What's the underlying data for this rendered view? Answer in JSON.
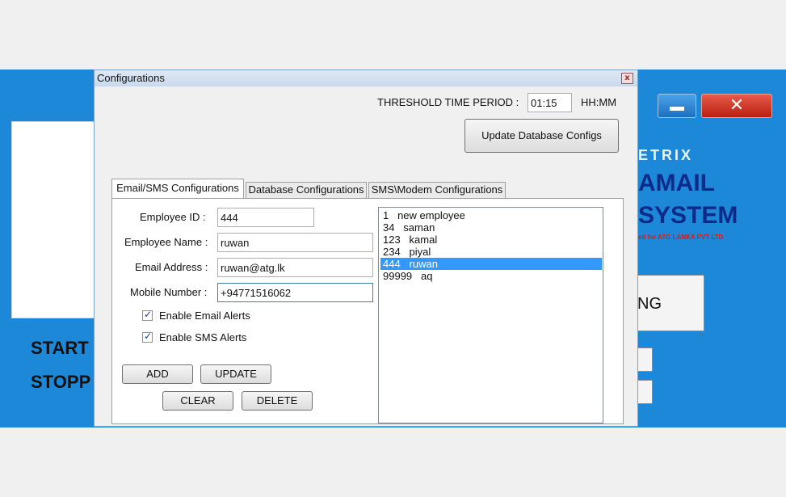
{
  "background_app": {
    "start_label": "START",
    "stop_label": "STOPP",
    "logo_line1": "ETRIX",
    "logo_line2": "AMAIL",
    "logo_line3": "SYSTEM",
    "logo_line4": "ed for ATG LANKA PVT LTD",
    "big_button_label": "NG",
    "minimize_icon": "minimize-icon",
    "close_icon": "close-icon",
    "close_glyph": "✕"
  },
  "dialog": {
    "title": "Configurations",
    "close_glyph": "x",
    "threshold_label": "THRESHOLD TIME PERIOD :",
    "threshold_value": "01:15",
    "threshold_format": "HH:MM",
    "update_db_button": "Update Database Configs",
    "tabs": [
      {
        "label": "Email/SMS Configurations",
        "active": true
      },
      {
        "label": "Database Configurations",
        "active": false
      },
      {
        "label": "SMS\\Modem Configurations",
        "active": false
      }
    ],
    "form": {
      "employee_id_label": "Employee ID :",
      "employee_id_value": "444",
      "employee_name_label": "Employee Name :",
      "employee_name_value": "ruwan",
      "email_label": "Email Address :",
      "email_value": "ruwan@atg.lk",
      "mobile_label": "Mobile Number :",
      "mobile_value": "+94771516062",
      "email_alerts_label": "Enable Email Alerts",
      "email_alerts_checked": true,
      "sms_alerts_label": "Enable SMS Alerts",
      "sms_alerts_checked": true,
      "check_glyph": "✓"
    },
    "buttons": {
      "add": "ADD",
      "update": "UPDATE",
      "clear": "CLEAR",
      "delete": "DELETE"
    },
    "employees": [
      {
        "text": "1   new employee",
        "selected": false
      },
      {
        "text": "34   saman",
        "selected": false
      },
      {
        "text": "123   kamal",
        "selected": false
      },
      {
        "text": "234   piyal",
        "selected": false
      },
      {
        "text": "444   ruwan",
        "selected": true
      },
      {
        "text": "99999   aq",
        "selected": false
      }
    ],
    "colors": {
      "selection": "#3399ff",
      "app_background": "#1e88d8"
    }
  }
}
